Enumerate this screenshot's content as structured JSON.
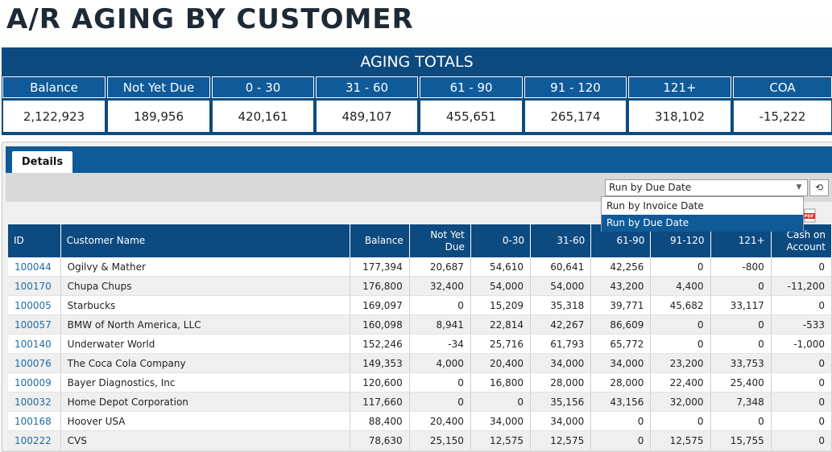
{
  "page": {
    "title": "A/R AGING BY CUSTOMER"
  },
  "totals": {
    "title": "AGING TOTALS",
    "headers": [
      "Balance",
      "Not Yet Due",
      "0 - 30",
      "31 - 60",
      "61 - 90",
      "91 - 120",
      "121+",
      "COA"
    ],
    "values": [
      "2,122,923",
      "189,956",
      "420,161",
      "489,107",
      "455,651",
      "265,174",
      "318,102",
      "-15,222"
    ]
  },
  "details": {
    "tab_label": "Details",
    "run_select": {
      "value": "Run by Due Date",
      "options": [
        "Run by Invoice Date",
        "Run by Due Date"
      ]
    },
    "refresh_icon": "refresh-icon",
    "pdf_icon": "pdf-icon"
  },
  "grid": {
    "columns": [
      "ID",
      "Customer Name",
      "Balance",
      "Not Yet Due",
      "0-30",
      "31-60",
      "61-90",
      "91-120",
      "121+",
      "Cash on Account"
    ],
    "rows": [
      [
        "100044",
        "Ogilvy & Mather",
        "177,394",
        "20,687",
        "54,610",
        "60,641",
        "42,256",
        "0",
        "-800",
        "0"
      ],
      [
        "100170",
        "Chupa Chups",
        "176,800",
        "32,400",
        "54,000",
        "54,000",
        "43,200",
        "4,400",
        "0",
        "-11,200"
      ],
      [
        "100005",
        "Starbucks",
        "169,097",
        "0",
        "15,209",
        "35,318",
        "39,771",
        "45,682",
        "33,117",
        "0"
      ],
      [
        "100057",
        "BMW of North America, LLC",
        "160,098",
        "8,941",
        "22,814",
        "42,267",
        "86,609",
        "0",
        "0",
        "-533"
      ],
      [
        "100140",
        "Underwater World",
        "152,246",
        "-34",
        "25,716",
        "61,793",
        "65,772",
        "0",
        "0",
        "-1,000"
      ],
      [
        "100076",
        "The Coca Cola Company",
        "149,353",
        "4,000",
        "20,400",
        "34,000",
        "34,000",
        "23,200",
        "33,753",
        "0"
      ],
      [
        "100009",
        "Bayer Diagnostics, Inc",
        "120,600",
        "0",
        "16,800",
        "28,000",
        "28,000",
        "22,400",
        "25,400",
        "0"
      ],
      [
        "100032",
        "Home Depot Corporation",
        "117,660",
        "0",
        "0",
        "35,156",
        "43,156",
        "32,000",
        "7,348",
        "0"
      ],
      [
        "100168",
        "Hoover USA",
        "88,400",
        "20,400",
        "34,000",
        "34,000",
        "0",
        "0",
        "0",
        "0"
      ],
      [
        "100222",
        "CVS",
        "78,630",
        "25,150",
        "12,575",
        "12,575",
        "0",
        "12,575",
        "15,755",
        "0"
      ]
    ]
  }
}
